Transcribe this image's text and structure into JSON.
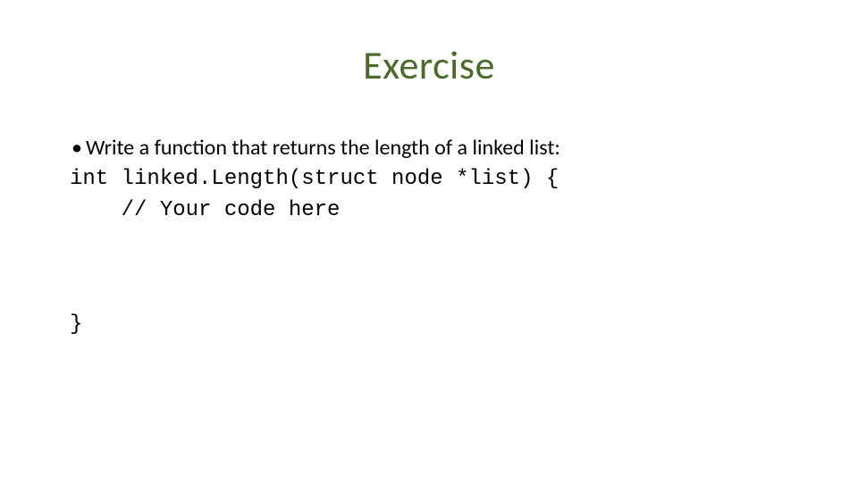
{
  "title": "Exercise",
  "bullet": {
    "marker": "•",
    "text": "Write a function that returns the length of a linked list:"
  },
  "code": {
    "line1": "int linked.Length(struct node *list) {",
    "line2": "    // Your code here",
    "line3": "}"
  },
  "colors": {
    "title": "#4a6b2a",
    "text": "#000000",
    "background": "#ffffff"
  }
}
